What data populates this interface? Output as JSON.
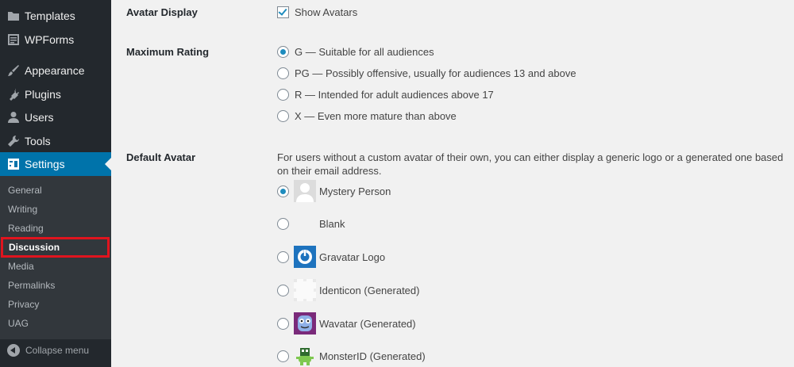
{
  "sidebar": {
    "items": [
      {
        "label": "Templates",
        "icon": "folder-icon"
      },
      {
        "label": "WPForms",
        "icon": "wpforms-icon"
      },
      {
        "label": "Appearance",
        "icon": "paintbrush-icon"
      },
      {
        "label": "Plugins",
        "icon": "plugin-icon"
      },
      {
        "label": "Users",
        "icon": "user-icon"
      },
      {
        "label": "Tools",
        "icon": "wrench-icon"
      },
      {
        "label": "Settings",
        "icon": "settings-icon"
      }
    ],
    "submenu": [
      "General",
      "Writing",
      "Reading",
      "Discussion",
      "Media",
      "Permalinks",
      "Privacy",
      "UAG"
    ],
    "active_submenu": "Discussion",
    "collapse_label": "Collapse menu"
  },
  "settings": {
    "avatar_display": {
      "label": "Avatar Display",
      "checkbox_label": "Show Avatars",
      "checked": true
    },
    "max_rating": {
      "label": "Maximum Rating",
      "options": [
        "G — Suitable for all audiences",
        "PG — Possibly offensive, usually for audiences 13 and above",
        "R — Intended for adult audiences above 17",
        "X — Even more mature than above"
      ],
      "selected": "G — Suitable for all audiences"
    },
    "default_avatar": {
      "label": "Default Avatar",
      "description": "For users without a custom avatar of their own, you can either display a generic logo or a generated one based on their email address.",
      "options": [
        "Mystery Person",
        "Blank",
        "Gravatar Logo",
        "Identicon (Generated)",
        "Wavatar (Generated)",
        "MonsterID (Generated)"
      ],
      "selected": "Mystery Person"
    }
  },
  "colors": {
    "sidebar_bg": "#23282d",
    "submenu_bg": "#32373c",
    "accent": "#0073aa",
    "highlight_border": "#e0141e",
    "radio_dot": "#1e8cbe"
  }
}
